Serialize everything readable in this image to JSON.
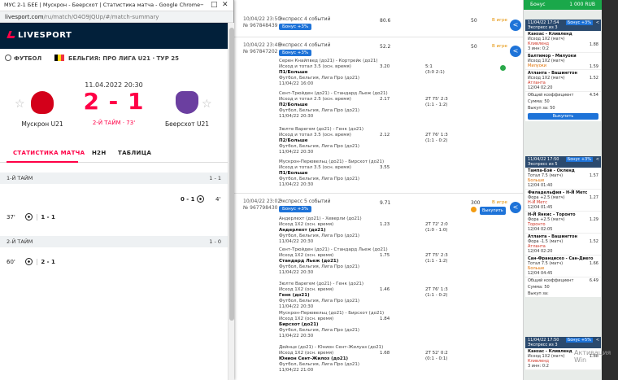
{
  "window": {
    "title": "МУС 2-1 БЕЕ | Мускрон - Беерсхот | Статистика матча - Google Chrome",
    "url_host": "livesport.com",
    "url_path": "/ru/match/O4O9JQUp/#/match-summary"
  },
  "livesport": {
    "logo": "LIVESPORT",
    "sport": "ФУТБОЛ",
    "league": "БЕЛЬГИЯ: ПРО ЛИГА U21 · ТУР 25",
    "date": "11.04.2022 20:30",
    "home": {
      "name": "Мускрон U21",
      "color": "#d3001a"
    },
    "away": {
      "name": "Беерсхот U21",
      "color": "#6b3fa0"
    },
    "score": "2 - 1",
    "status": "2-Й ТАЙМ · 73'",
    "tabs": [
      "СТАТИСТИКА МАТЧА",
      "H2H",
      "ТАБЛИЦА"
    ],
    "first_half": {
      "label": "1-Й ТАЙМ",
      "score": "1 - 1"
    },
    "second_half": {
      "label": "2-Й ТАЙМ",
      "score": "1 - 0"
    },
    "incidents": [
      {
        "minute": "4'",
        "score": "0 - 1",
        "side": "away"
      },
      {
        "minute": "37'",
        "score": "1 - 1",
        "side": "home"
      },
      {
        "minute": "60'",
        "score": "2 - 1",
        "side": "home"
      }
    ]
  },
  "bets": {
    "t1": {
      "date": "10/04/22 23:50",
      "id": "№ 967848439",
      "type": "Экспресс 4 событий",
      "bonus": "Бонус +3%",
      "coef": "80.6",
      "stake": "50",
      "status": "В игре"
    },
    "t2": {
      "date": "10/04/22 23:48",
      "id": "№ 967847202",
      "type": "Экспресс 4 событий",
      "bonus": "Бонус +3%",
      "coef": "52.2",
      "stake": "50",
      "status": "В игре",
      "events": [
        {
          "teams": "Серен Кнайпвед (до21) - Кортрейк (до21)",
          "market": "Исход и тотал 3.5 (осн. время)",
          "pick": "П1/Больше",
          "info": "Футбол, Бельгия, Лига Про (до21)",
          "time": "11/04/22 16:00",
          "odd": "3.20",
          "res1": "5:1",
          "res2": "(3:0 2:1)"
        },
        {
          "teams": "Сент-Трюйден (до21) - Стандард Льеж (до21)",
          "market": "Исход и тотал 2.5 (осн. время)",
          "pick": "П2/Больше",
          "info": "Футбол, Бельгия, Лига Про (до21)",
          "time": "11/04/22 20:30",
          "odd": "2.17",
          "res1": "2Т 75' 2:3",
          "res2": "(1:1 - 1:2)"
        },
        {
          "teams": "Зюлте Варегем (до21) - Генк (до21)",
          "market": "Исход и тотал 3.5 (осн. время)",
          "pick": "П2/Больше",
          "info": "Футбол, Бельгия, Лига Про (до21)",
          "time": "11/04/22 20:30",
          "odd": "2.12",
          "res1": "2Т 76' 1:3",
          "res2": "(1:1 - 0:2)"
        },
        {
          "teams": "Мускрон-Перювельц (до21) - Бирсхот (до21)",
          "market": "Исход и тотал 3.5 (осн. время)",
          "pick": "П1/Больше",
          "info": "Футбол, Бельгия, Лига Про (до21)",
          "time": "11/04/22 20:30",
          "odd": "3.55",
          "res1": "",
          "res2": ""
        }
      ]
    },
    "t3": {
      "date": "10/04/22 23:02",
      "id": "№ 967798430",
      "type": "Экспресс 5 событий",
      "bonus": "Бонус +3%",
      "coef": "9.71",
      "stake": "300",
      "status": "В игре",
      "cashout": "Выкупить",
      "events": [
        {
          "teams": "Андерлехт (до21) - Хеверли (до21)",
          "market": "Исход 1Х2 (осн. время)",
          "pick": "Андерлехт (до21)",
          "info": "Футбол, Бельгия, Лига Про (до21)",
          "time": "11/04/22 20:30",
          "odd": "1.23",
          "res1": "2Т 72' 2:0",
          "res2": "(1:0 - 1:0)"
        },
        {
          "teams": "Сент-Трюйден (до21) - Стандард Льеж (до21)",
          "market": "Исход 1Х2 (осн. время)",
          "pick": "Стандард Льеж (до21)",
          "info": "Футбол, Бельгия, Лига Про (до21)",
          "time": "11/04/22 20:30",
          "odd": "1.75",
          "res1": "2Т 75' 2:3",
          "res2": "(1:1 - 1:2)"
        },
        {
          "teams": "Зюлте Варегем (до21) - Генк (до21)",
          "market": "Исход 1Х2 (осн. время)",
          "pick": "Генк (до21)",
          "info": "Футбол, Бельгия, Лига Про (до21)",
          "time": "11/04/22 20:30",
          "odd": "1.46",
          "res1": "2Т 76' 1:3",
          "res2": "(1:1 - 0:2)"
        },
        {
          "teams": "Мускрон-Перювельц (до21) - Бирсхот (до21)",
          "market": "Исход 1Х2 (осн. время)",
          "pick": "Бирсхот (до21)",
          "info": "Футбол, Бельгия, Лига Про (до21)",
          "time": "11/04/22 20:30",
          "odd": "1.84",
          "res1": "",
          "res2": ""
        },
        {
          "teams": "Дейнце (до21) - Юнион Сент-Жилуаз (до21)",
          "market": "Исход 1Х2 (осн. время)",
          "pick": "Юнион Сент-Жилоз (до21)",
          "info": "Футбол, Бельгия, Лига Про (до21)",
          "time": "11/04/22 21:00",
          "odd": "1.68",
          "res1": "2Т 52' 0:2",
          "res2": "(0:1 - 0:1)"
        }
      ]
    }
  },
  "coupon": {
    "bonus_label": "Бонус",
    "balance": "1 000 RUB",
    "c1": {
      "date": "11/04/22 17:54",
      "type": "Экспресс из 3",
      "bonus": "Бонус +3%",
      "events": [
        {
          "name": "Канзас - Кливленд",
          "market": "Исход 1Х2 (матч)",
          "pick": "Кливленд",
          "extra": "3 инн: 0:2",
          "odd": "1.88"
        },
        {
          "name": "Балтимор - Милуоки",
          "market": "Исход 1Х2 (матч)",
          "pick": "Милуоки",
          "extra": "",
          "odd": "1.59"
        },
        {
          "name": "Атланта - Вашингтон",
          "market": "Исход 1Х2 (матч)",
          "pick": "Атланта",
          "extra": "12/04 02:20",
          "odd": "1.52"
        }
      ],
      "total_label": "Общий коэффициент",
      "total": "4.54",
      "sum_label": "Сумма:",
      "sum": "50",
      "cash_label": "Выкуп за:",
      "cash": "50",
      "cash_btn": "Выкупить"
    },
    "c2": {
      "date": "11/04/22 17:50",
      "type": "Экспресс из 5",
      "bonus": "Бонус +3%",
      "events": [
        {
          "name": "Тампа-Бэй - Окленд",
          "market": "Тотал 7.5 (матч)",
          "pick": "Больше",
          "extra": "12/04 01:40",
          "odd": "1.57"
        },
        {
          "name": "Филадельфия - Н-Й Метс",
          "market": "Фора +2.5 (матч)",
          "pick": "Н-Й Метс",
          "extra": "12/04 01:45",
          "odd": "1.27"
        },
        {
          "name": "Н-Й Янкис - Торонто",
          "market": "Фора +2.5 (матч)",
          "pick": "Торонто",
          "extra": "12/04 02:05",
          "odd": "1.29"
        },
        {
          "name": "Атланта - Вашингтон",
          "market": "Фора -1.5 (матч)",
          "pick": "Атланта",
          "extra": "12/04 02:20",
          "odd": "1.52"
        },
        {
          "name": "Сан-Франциско - Сан-Диего",
          "market": "Тотал 7.5 (матч)",
          "pick": "Больше",
          "extra": "12/04 04:45",
          "odd": "1.66"
        }
      ],
      "total_label": "Общий коэффициент",
      "total": "6.49",
      "sum_label": "Сумма:",
      "sum": "50",
      "cash_label": "Выкуп за:"
    },
    "c3": {
      "date": "11/04/22 17:50",
      "type": "Экспресс из 3",
      "bonus": "Бонус +5%",
      "events": [
        {
          "name": "Канзас - Кливленд",
          "market": "Исход 1Х2 (матч)",
          "pick": "Кливленд",
          "extra": "3 инн: 0:2",
          "odd": "1.88"
        }
      ]
    }
  },
  "activation_text": "Активация Win"
}
